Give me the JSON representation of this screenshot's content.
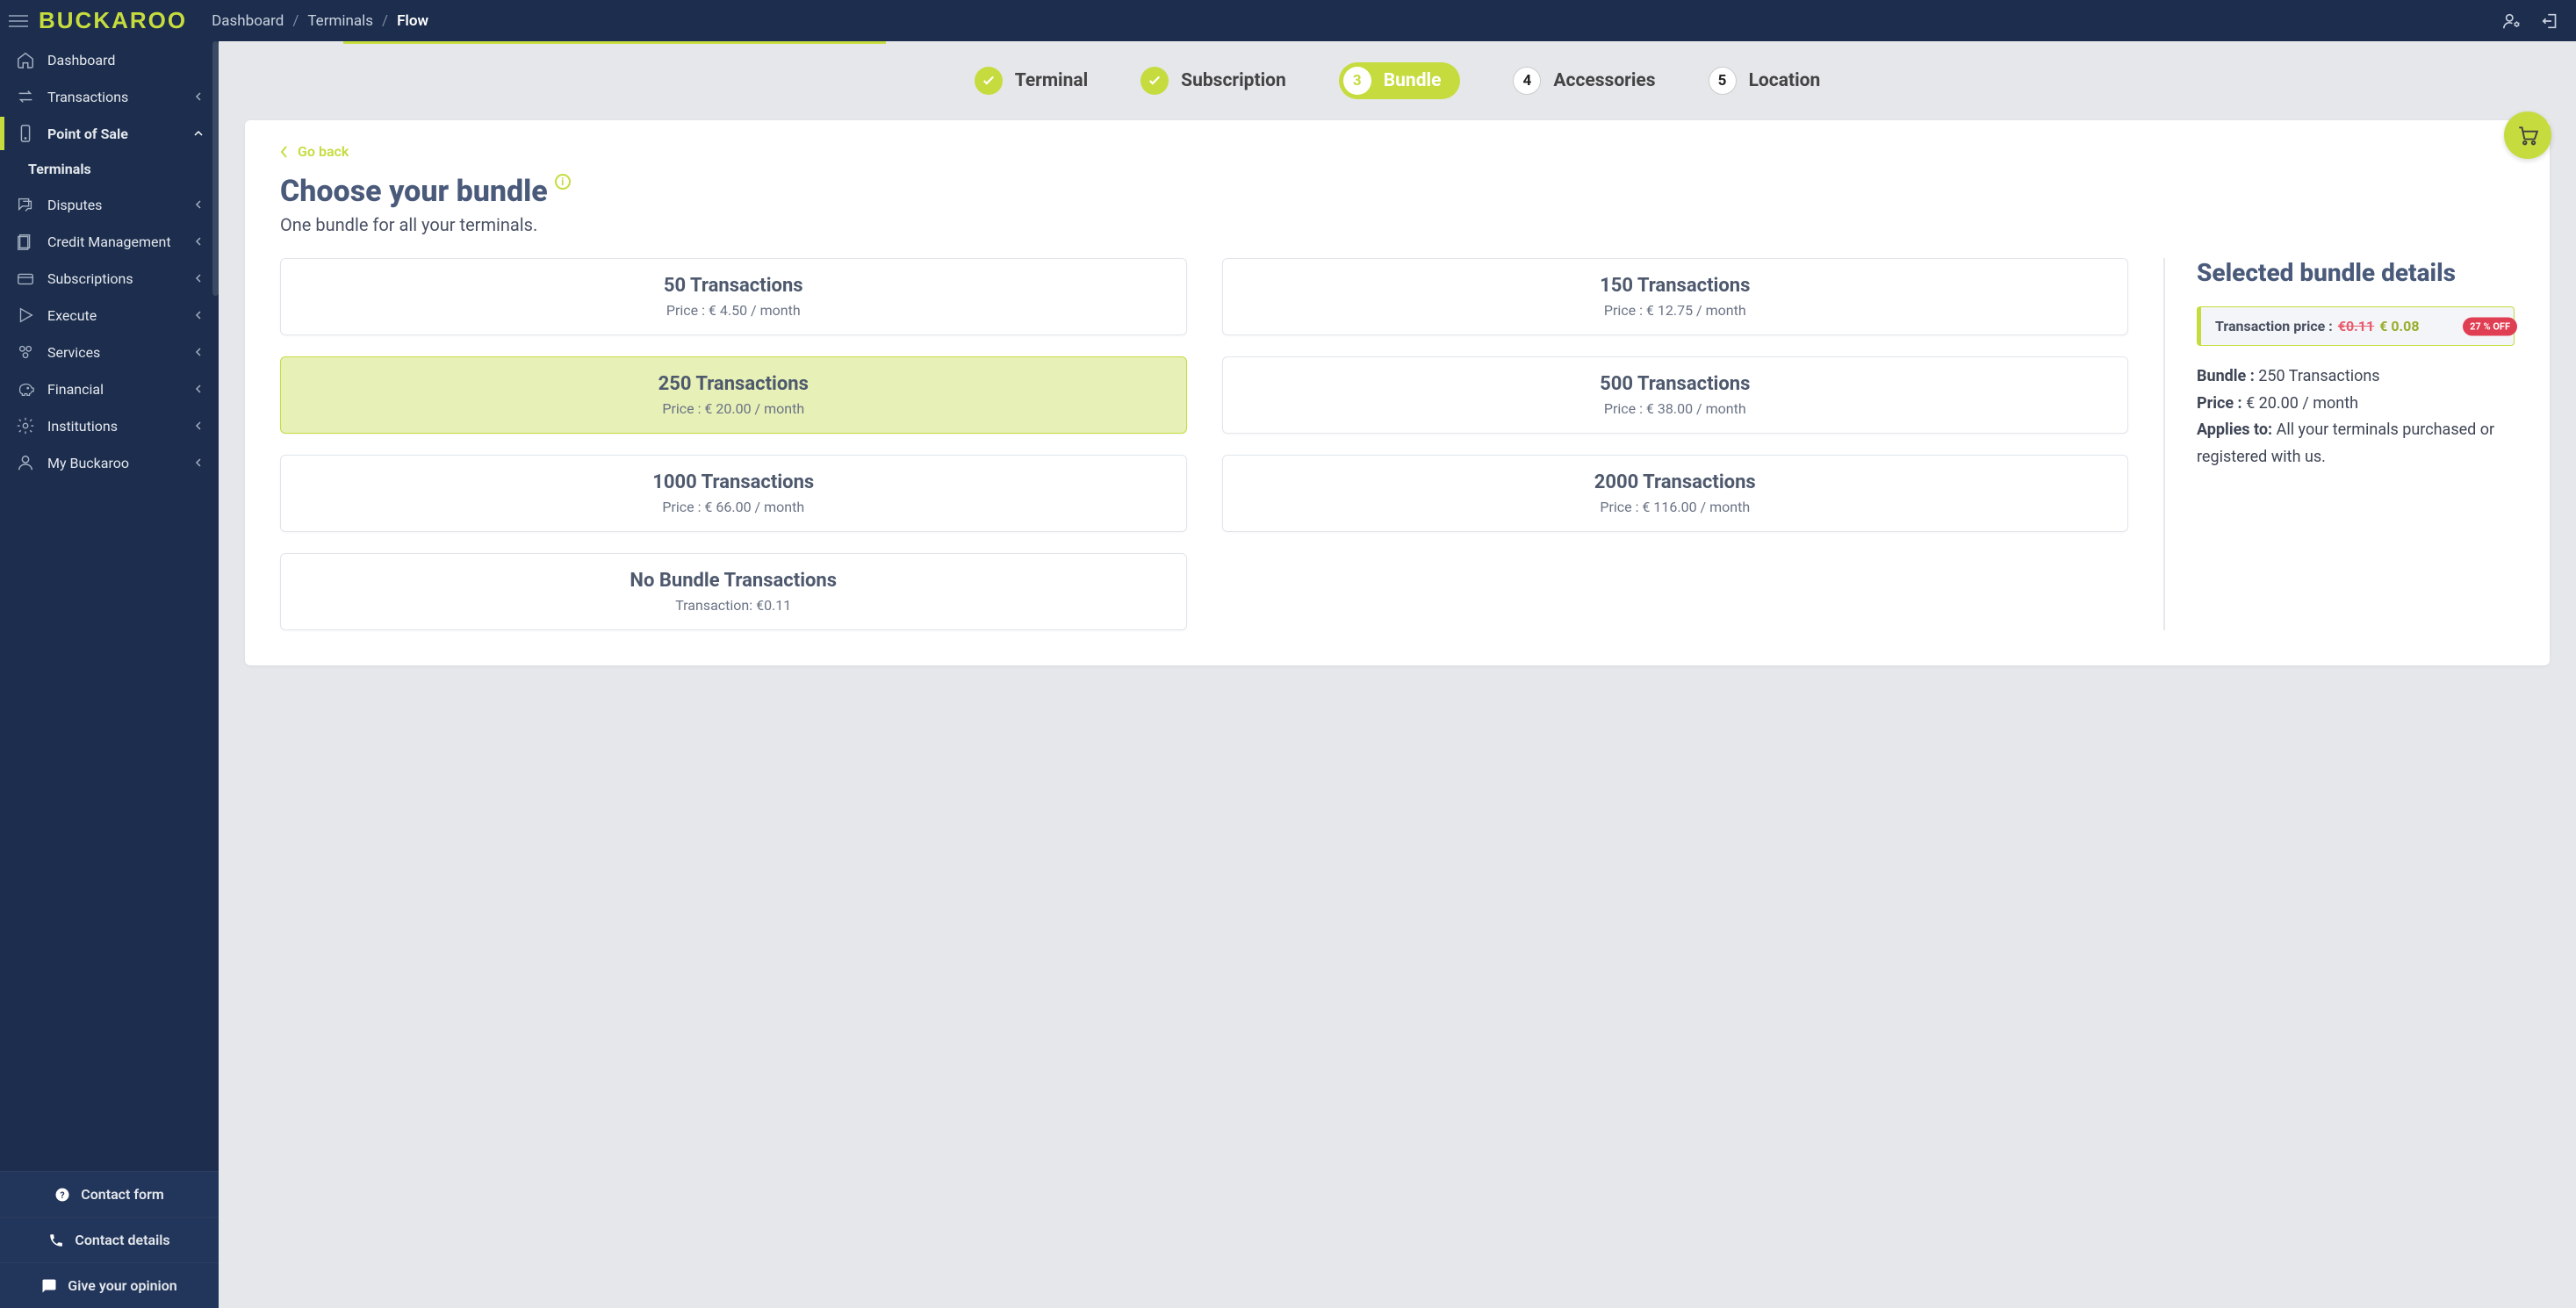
{
  "breadcrumb": {
    "seg1": "Dashboard",
    "seg2": "Terminals",
    "current": "Flow",
    "sep": "/"
  },
  "logo_text": "BUCKAROO",
  "sidebar": {
    "items": [
      {
        "label": "Dashboard"
      },
      {
        "label": "Transactions"
      },
      {
        "label": "Point of Sale"
      },
      {
        "label": "Terminals"
      },
      {
        "label": "Disputes"
      },
      {
        "label": "Credit Management"
      },
      {
        "label": "Subscriptions"
      },
      {
        "label": "Execute"
      },
      {
        "label": "Services"
      },
      {
        "label": "Financial"
      },
      {
        "label": "Institutions"
      },
      {
        "label": "My Buckaroo"
      }
    ],
    "contact_form": "Contact form",
    "contact_details": "Contact details",
    "opinion": "Give your opinion"
  },
  "stepper": {
    "s1": "Terminal",
    "s2": "Subscription",
    "s3": "Bundle",
    "s3num": "3",
    "s4": "Accessories",
    "s4num": "4",
    "s5": "Location",
    "s5num": "5"
  },
  "goback": "Go back",
  "heading": "Choose your bundle",
  "subtitle": "One bundle for all your terminals.",
  "bundles": [
    {
      "title": "50 Transactions",
      "price": "Price : € 4.50 / month"
    },
    {
      "title": "150 Transactions",
      "price": "Price : € 12.75 / month"
    },
    {
      "title": "250 Transactions",
      "price": "Price : € 20.00 / month"
    },
    {
      "title": "500 Transactions",
      "price": "Price : € 38.00 / month"
    },
    {
      "title": "1000 Transactions",
      "price": "Price : € 66.00 / month"
    },
    {
      "title": "2000 Transactions",
      "price": "Price : € 116.00 / month"
    },
    {
      "title": "No Bundle Transactions",
      "price": "Transaction: €0.11"
    }
  ],
  "selected_index": 2,
  "details": {
    "heading": "Selected bundle details",
    "tx_label": "Transaction price :",
    "old_price": "€0.11",
    "new_price": "€ 0.08",
    "off_badge": "27 % OFF",
    "bundle_label": "Bundle :",
    "bundle_value": "250 Transactions",
    "price_label": "Price :",
    "price_value": "€ 20.00 / month",
    "applies_label": "Applies to:",
    "applies_value": "All your terminals purchased or registered with us."
  }
}
